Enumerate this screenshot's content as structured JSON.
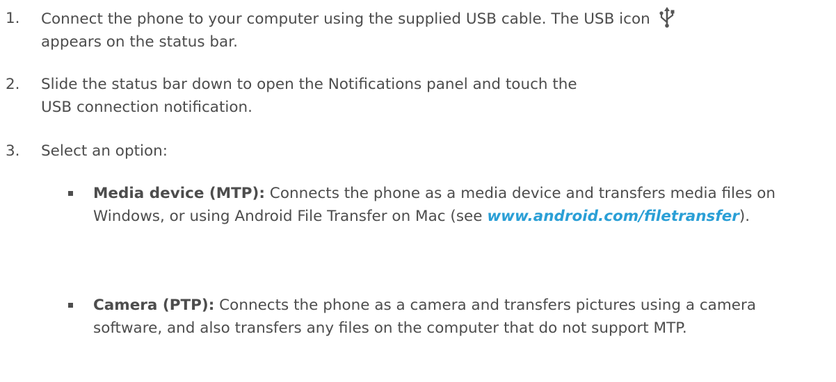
{
  "steps": [
    {
      "number": "1.",
      "text_before_icon": "Connect the phone to your computer using the supplied USB cable. The USB icon",
      "icon": "usb-icon",
      "text_after_icon": "appears on the status bar."
    },
    {
      "number": "2.",
      "text": "Slide the status bar down to open the Notifications panel and touch the USB connection notification."
    },
    {
      "number": "3.",
      "text": "Select an option:"
    }
  ],
  "options": [
    {
      "term": "Media device (MTP):",
      "description_before_link": " Connects the phone as a media device and transfers media files on Windows, or using Android File Transfer on Mac (see ",
      "link": "www.android.com/filetransfer",
      "description_after_link": ")."
    },
    {
      "term": "Camera (PTP):",
      "description": " Connects the phone as a camera and transfers pictures using a camera software, and also transfers any files on the computer that do not support MTP."
    }
  ],
  "colors": {
    "text": "#4d4d4d",
    "link": "#2a9fd6"
  }
}
